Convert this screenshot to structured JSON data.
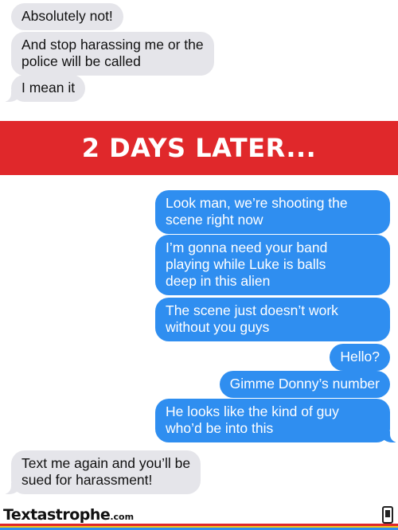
{
  "messages_top": [
    {
      "text": "Absolutely not!",
      "side": "received"
    },
    {
      "text": "And stop harassing me or the\npolice will be called",
      "side": "received"
    },
    {
      "text": "I mean it",
      "side": "received"
    }
  ],
  "banner": {
    "text": "2 DAYS LATER..."
  },
  "messages_bottom": [
    {
      "text": "Look man, we’re shooting the\nscene right now",
      "side": "sent"
    },
    {
      "text": "I’m gonna need your band\nplaying while Luke is balls\ndeep in this alien",
      "side": "sent"
    },
    {
      "text": "The scene just doesn’t work\nwithout you guys",
      "side": "sent"
    },
    {
      "text": "Hello?",
      "side": "sent"
    },
    {
      "text": "Gimme Donny’s number",
      "side": "sent"
    },
    {
      "text": "He looks like the kind of guy\nwho’d be into this",
      "side": "sent"
    },
    {
      "text": "Text me again and you’ll be\nsued for harassment!",
      "side": "received"
    }
  ],
  "footer": {
    "brand": "Textastrophe",
    "brand_suffix": ".com",
    "icon": "phone-icon",
    "stripe_colors": [
      "#e0282b",
      "#f5c518",
      "#2f8ef0"
    ]
  },
  "colors": {
    "sent_bubble": "#2f8ef0",
    "received_bubble": "#e5e5ea",
    "banner": "#e0282b"
  }
}
